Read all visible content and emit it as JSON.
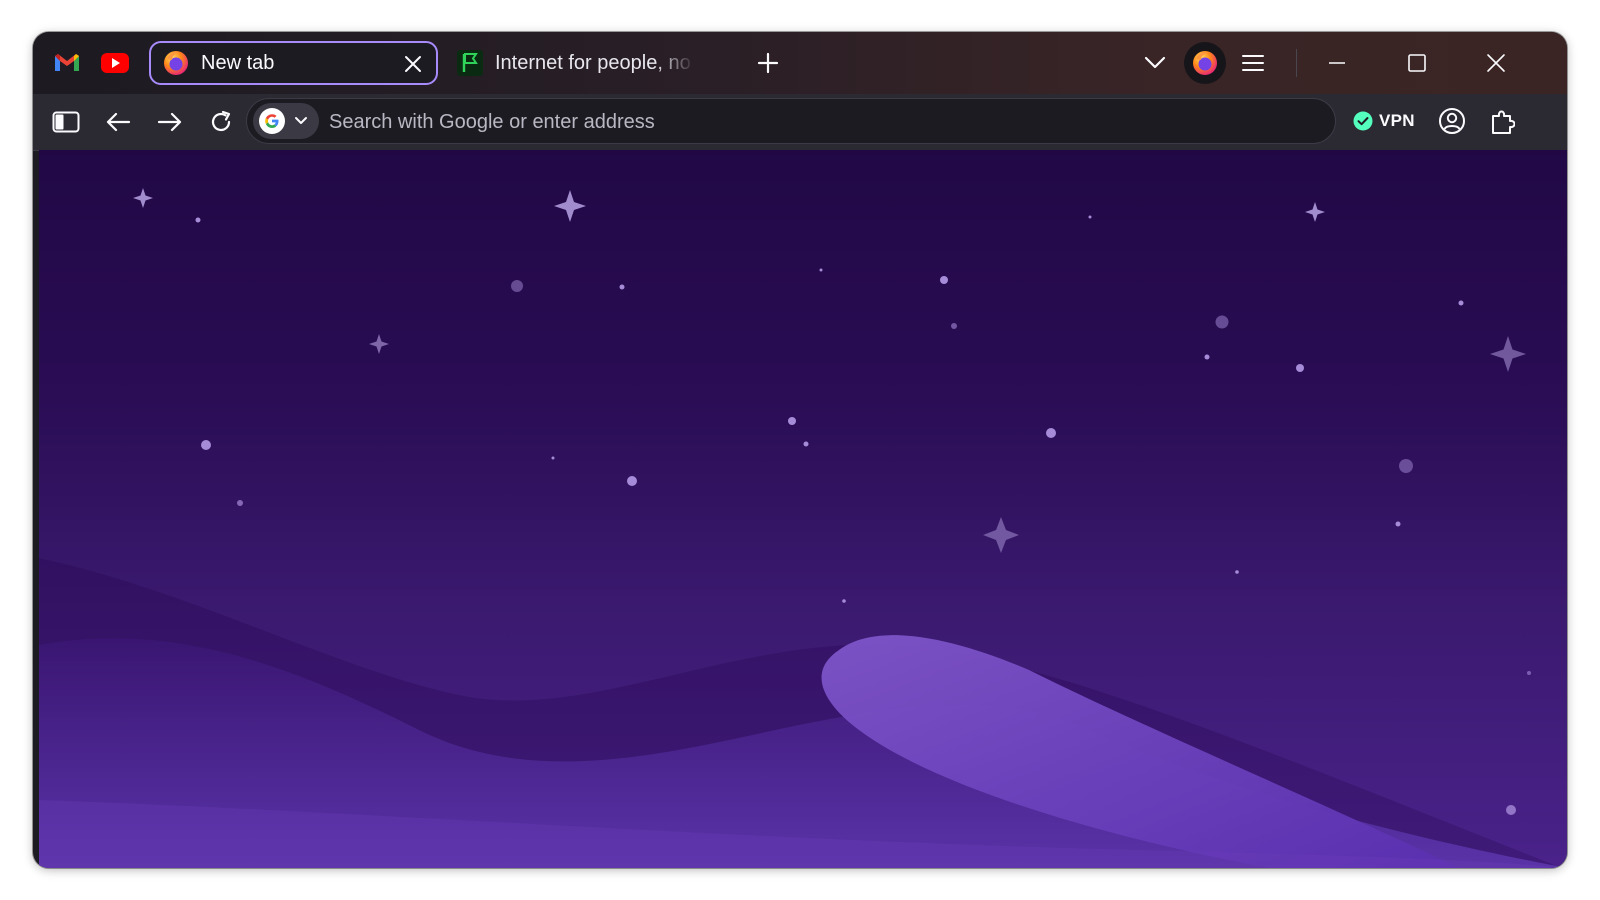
{
  "window": {
    "pinned_tabs": [
      {
        "name": "Gmail",
        "icon": "gmail-icon"
      },
      {
        "name": "YouTube",
        "icon": "youtube-icon"
      }
    ],
    "tabs": [
      {
        "title": "New tab",
        "icon": "firefox-icon",
        "active": true
      },
      {
        "title": "Internet for people, no",
        "icon": "green-flag-icon",
        "active": false
      }
    ],
    "new_tab_icon": "plus-icon",
    "controls": [
      "chevron-down-icon",
      "firefox-account-icon",
      "hamburger-menu-icon",
      "minimize-icon",
      "maximize-icon",
      "close-icon"
    ]
  },
  "navbar": {
    "buttons": [
      "sidebar-icon",
      "back-arrow-icon",
      "forward-arrow-icon",
      "reload-icon"
    ],
    "search": {
      "engine_icon": "google-icon",
      "placeholder": "Search with Google or enter address",
      "value": ""
    },
    "vpn": {
      "label": "VPN",
      "status_color": "#54ffbd"
    },
    "right_icons": [
      "account-icon",
      "extensions-icon"
    ]
  },
  "page": {
    "background": "purple-night-sky",
    "colors": {
      "sky_top": "#210845",
      "sky_bottom": "#4a228a",
      "accent": "#a78bfa"
    }
  }
}
